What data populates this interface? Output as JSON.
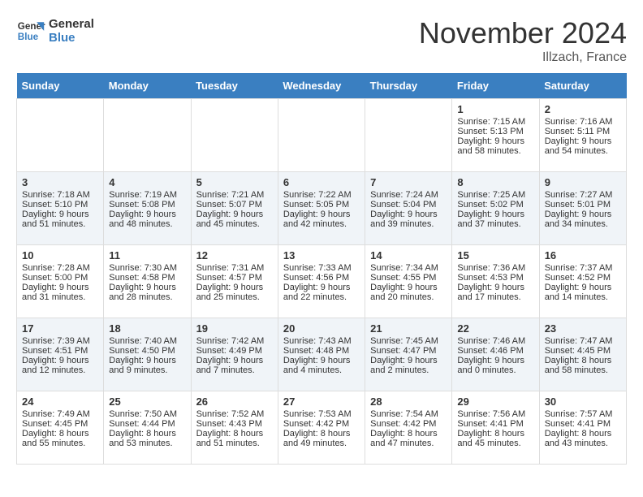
{
  "header": {
    "logo_line1": "General",
    "logo_line2": "Blue",
    "month_title": "November 2024",
    "location": "Illzach, France"
  },
  "days_of_week": [
    "Sunday",
    "Monday",
    "Tuesday",
    "Wednesday",
    "Thursday",
    "Friday",
    "Saturday"
  ],
  "weeks": [
    [
      {
        "day": "",
        "content": ""
      },
      {
        "day": "",
        "content": ""
      },
      {
        "day": "",
        "content": ""
      },
      {
        "day": "",
        "content": ""
      },
      {
        "day": "",
        "content": ""
      },
      {
        "day": "1",
        "content": "Sunrise: 7:15 AM\nSunset: 5:13 PM\nDaylight: 9 hours and 58 minutes."
      },
      {
        "day": "2",
        "content": "Sunrise: 7:16 AM\nSunset: 5:11 PM\nDaylight: 9 hours and 54 minutes."
      }
    ],
    [
      {
        "day": "3",
        "content": "Sunrise: 7:18 AM\nSunset: 5:10 PM\nDaylight: 9 hours and 51 minutes."
      },
      {
        "day": "4",
        "content": "Sunrise: 7:19 AM\nSunset: 5:08 PM\nDaylight: 9 hours and 48 minutes."
      },
      {
        "day": "5",
        "content": "Sunrise: 7:21 AM\nSunset: 5:07 PM\nDaylight: 9 hours and 45 minutes."
      },
      {
        "day": "6",
        "content": "Sunrise: 7:22 AM\nSunset: 5:05 PM\nDaylight: 9 hours and 42 minutes."
      },
      {
        "day": "7",
        "content": "Sunrise: 7:24 AM\nSunset: 5:04 PM\nDaylight: 9 hours and 39 minutes."
      },
      {
        "day": "8",
        "content": "Sunrise: 7:25 AM\nSunset: 5:02 PM\nDaylight: 9 hours and 37 minutes."
      },
      {
        "day": "9",
        "content": "Sunrise: 7:27 AM\nSunset: 5:01 PM\nDaylight: 9 hours and 34 minutes."
      }
    ],
    [
      {
        "day": "10",
        "content": "Sunrise: 7:28 AM\nSunset: 5:00 PM\nDaylight: 9 hours and 31 minutes."
      },
      {
        "day": "11",
        "content": "Sunrise: 7:30 AM\nSunset: 4:58 PM\nDaylight: 9 hours and 28 minutes."
      },
      {
        "day": "12",
        "content": "Sunrise: 7:31 AM\nSunset: 4:57 PM\nDaylight: 9 hours and 25 minutes."
      },
      {
        "day": "13",
        "content": "Sunrise: 7:33 AM\nSunset: 4:56 PM\nDaylight: 9 hours and 22 minutes."
      },
      {
        "day": "14",
        "content": "Sunrise: 7:34 AM\nSunset: 4:55 PM\nDaylight: 9 hours and 20 minutes."
      },
      {
        "day": "15",
        "content": "Sunrise: 7:36 AM\nSunset: 4:53 PM\nDaylight: 9 hours and 17 minutes."
      },
      {
        "day": "16",
        "content": "Sunrise: 7:37 AM\nSunset: 4:52 PM\nDaylight: 9 hours and 14 minutes."
      }
    ],
    [
      {
        "day": "17",
        "content": "Sunrise: 7:39 AM\nSunset: 4:51 PM\nDaylight: 9 hours and 12 minutes."
      },
      {
        "day": "18",
        "content": "Sunrise: 7:40 AM\nSunset: 4:50 PM\nDaylight: 9 hours and 9 minutes."
      },
      {
        "day": "19",
        "content": "Sunrise: 7:42 AM\nSunset: 4:49 PM\nDaylight: 9 hours and 7 minutes."
      },
      {
        "day": "20",
        "content": "Sunrise: 7:43 AM\nSunset: 4:48 PM\nDaylight: 9 hours and 4 minutes."
      },
      {
        "day": "21",
        "content": "Sunrise: 7:45 AM\nSunset: 4:47 PM\nDaylight: 9 hours and 2 minutes."
      },
      {
        "day": "22",
        "content": "Sunrise: 7:46 AM\nSunset: 4:46 PM\nDaylight: 9 hours and 0 minutes."
      },
      {
        "day": "23",
        "content": "Sunrise: 7:47 AM\nSunset: 4:45 PM\nDaylight: 8 hours and 58 minutes."
      }
    ],
    [
      {
        "day": "24",
        "content": "Sunrise: 7:49 AM\nSunset: 4:45 PM\nDaylight: 8 hours and 55 minutes."
      },
      {
        "day": "25",
        "content": "Sunrise: 7:50 AM\nSunset: 4:44 PM\nDaylight: 8 hours and 53 minutes."
      },
      {
        "day": "26",
        "content": "Sunrise: 7:52 AM\nSunset: 4:43 PM\nDaylight: 8 hours and 51 minutes."
      },
      {
        "day": "27",
        "content": "Sunrise: 7:53 AM\nSunset: 4:42 PM\nDaylight: 8 hours and 49 minutes."
      },
      {
        "day": "28",
        "content": "Sunrise: 7:54 AM\nSunset: 4:42 PM\nDaylight: 8 hours and 47 minutes."
      },
      {
        "day": "29",
        "content": "Sunrise: 7:56 AM\nSunset: 4:41 PM\nDaylight: 8 hours and 45 minutes."
      },
      {
        "day": "30",
        "content": "Sunrise: 7:57 AM\nSunset: 4:41 PM\nDaylight: 8 hours and 43 minutes."
      }
    ]
  ]
}
